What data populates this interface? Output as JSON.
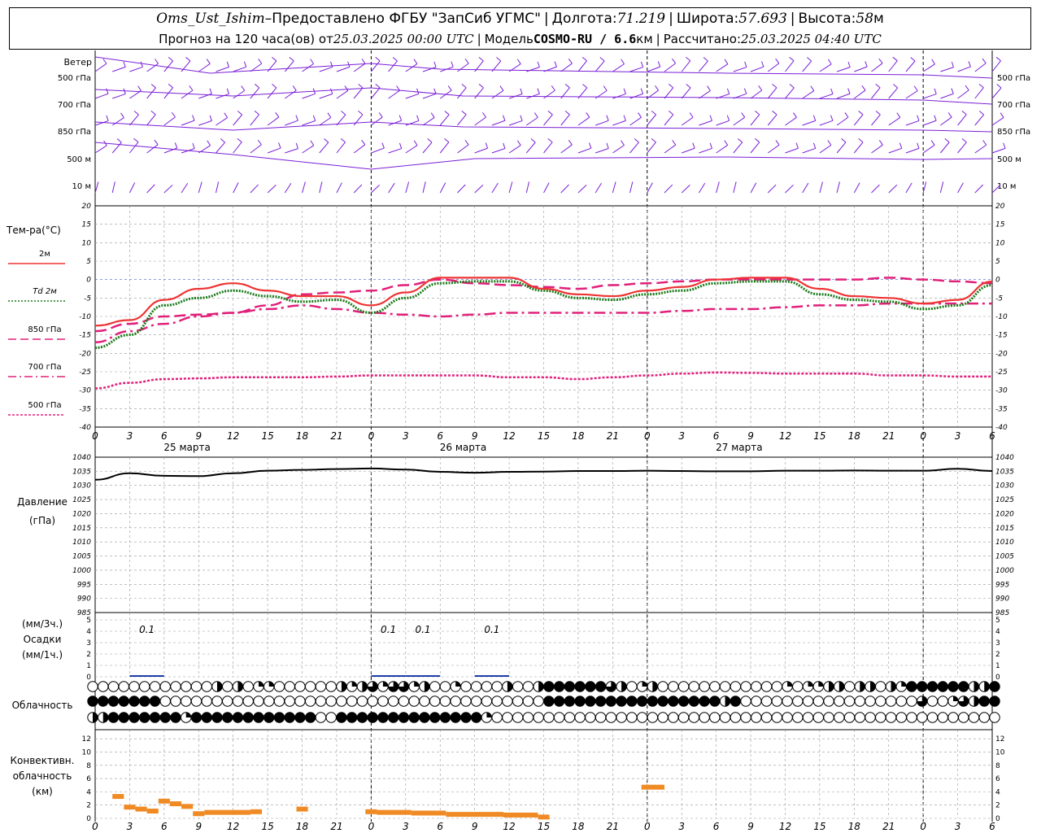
{
  "header": {
    "station": "Oms_Ust_Ishim",
    "dash": " – ",
    "provider": "Предоставлено ФГБУ \"ЗапСиб УГМС\"",
    "lon_label": "Долгота: ",
    "lon_value": "71.219",
    "lat_label": "Широта: ",
    "lat_value": "57.693",
    "alt_label": "Высота: ",
    "alt_value": "58",
    "alt_unit": "м",
    "forecast_label": "Прогноз на 120 часа(ов) от ",
    "forecast_date": "25.03.2025 00:00 UTC",
    "model_label": "Модель ",
    "model_value": "COSMO-RU / 6.6",
    "model_unit": "км",
    "calc_label": "Рассчитано: ",
    "calc_date": "25.03.2025 04:40 UTC",
    "separator": "|"
  },
  "time_axis": {
    "tick_labels": [
      "0",
      "3",
      "6",
      "9",
      "12",
      "15",
      "18",
      "21",
      "0",
      "3",
      "6",
      "9",
      "12",
      "15",
      "18",
      "21",
      "0",
      "3",
      "6",
      "9",
      "12",
      "15",
      "18",
      "21",
      "0",
      "3",
      "6"
    ],
    "days": [
      "25 марта",
      "26 марта",
      "27 марта"
    ]
  },
  "wind_panel": {
    "title": "Ветер",
    "levels": [
      "500 гПа",
      "700 гПа",
      "850 гПа",
      "500  м",
      "10  м"
    ],
    "right_levels": [
      "500 гПа",
      "700 гПа",
      "850 гПа",
      "500 м",
      "10 м"
    ],
    "color": "#7a1fd6"
  },
  "chart_data": [
    {
      "type": "line",
      "title": "Тем-ра(°С)",
      "ylim": [
        -40,
        20
      ],
      "y_ticks": [
        "20",
        "15",
        "10",
        "5",
        "0",
        "-5",
        "-10",
        "-15",
        "-20",
        "-25",
        "-30",
        "-35",
        "-40"
      ],
      "x_hours": [
        0,
        3,
        6,
        9,
        12,
        15,
        18,
        21,
        24,
        27,
        30,
        33,
        36,
        39,
        42,
        45,
        48,
        51,
        54,
        57,
        60,
        63,
        66,
        69,
        72,
        75,
        78
      ],
      "series": [
        {
          "name": "2м",
          "color": "#ee3333",
          "style": "solid",
          "values": [
            -12.5,
            -11,
            -5.5,
            -2.5,
            -1,
            -3,
            -4.5,
            -4.5,
            -7,
            -3.5,
            0.5,
            0.5,
            0.5,
            -2.5,
            -4,
            -4.5,
            -3,
            -2,
            0,
            0.5,
            0.5,
            -2.5,
            -4.5,
            -5,
            -6.5,
            -5.5,
            -0.5
          ]
        },
        {
          "name": "Td  2м",
          "color": "#1a7a1a",
          "style": "dotted",
          "values": [
            -18.5,
            -15,
            -7,
            -5,
            -3,
            -4.5,
            -6,
            -5.5,
            -9,
            -5,
            -1,
            -0.5,
            -0.5,
            -3,
            -5,
            -5.5,
            -4,
            -3,
            -1,
            -0.5,
            -0.5,
            -4,
            -5.5,
            -6,
            -8,
            -7,
            -1.5
          ]
        },
        {
          "name": "850 гПа",
          "color": "#e0207a",
          "style": "dash",
          "values": [
            -14,
            -12,
            -10,
            -9.5,
            -9,
            -7,
            -4,
            -3.5,
            -3,
            -1.5,
            0,
            -1,
            -1.5,
            -2,
            -2.5,
            -1.5,
            -1,
            -0.5,
            0,
            0,
            0,
            0,
            0,
            0.5,
            0,
            -0.5,
            -1
          ]
        },
        {
          "name": "700 гПа",
          "color": "#e0207a",
          "style": "dashdot",
          "values": [
            -17,
            -14,
            -12,
            -10,
            -9,
            -8,
            -7,
            -8,
            -9,
            -9.5,
            -10,
            -9.5,
            -9,
            -9,
            -9,
            -9,
            -9,
            -8.5,
            -8,
            -8,
            -7.5,
            -7,
            -7,
            -6.5,
            -6.5,
            -6.5,
            -6.5
          ]
        },
        {
          "name": "500 гПа",
          "color": "#e0207a",
          "style": "densedot",
          "values": [
            -29.5,
            -28,
            -27,
            -26.8,
            -26.5,
            -26.5,
            -26.5,
            -26.3,
            -26,
            -26,
            -26,
            -26,
            -26.5,
            -26.5,
            -27,
            -26.5,
            -26,
            -25.5,
            -25.2,
            -25.3,
            -25.5,
            -25.5,
            -25.5,
            -26,
            -26,
            -26.3,
            -26.3
          ]
        }
      ]
    },
    {
      "type": "line",
      "title": "Давление",
      "unit": "(гПа)",
      "ylim": [
        985,
        1040
      ],
      "y_ticks": [
        "1040",
        "1035",
        "1030",
        "1025",
        "1020",
        "1015",
        "1010",
        "1005",
        "1000",
        "995",
        "990",
        "985"
      ],
      "x_hours": [
        0,
        3,
        6,
        9,
        12,
        15,
        18,
        21,
        24,
        27,
        30,
        33,
        36,
        39,
        42,
        45,
        48,
        51,
        54,
        57,
        60,
        63,
        66,
        69,
        72,
        75,
        78
      ],
      "series": [
        {
          "name": "Давление",
          "color": "#000000",
          "values": [
            1032,
            1034.3,
            1033.4,
            1033.3,
            1034.3,
            1035.2,
            1035.5,
            1035.8,
            1036,
            1035.6,
            1034.8,
            1034.5,
            1034.8,
            1034.9,
            1035.1,
            1035.1,
            1035.2,
            1035.1,
            1035,
            1035,
            1035.2,
            1035.2,
            1035.3,
            1035.2,
            1035.2,
            1035.9,
            1035.1
          ]
        }
      ]
    },
    {
      "type": "bar",
      "title": "Осадки",
      "unit_top": "(мм/3ч.)",
      "unit_bottom": "(мм/1ч.)",
      "ylim": [
        0,
        5
      ],
      "y_ticks": [
        "5",
        "4",
        "3",
        "2",
        "1",
        "0"
      ],
      "bars": [
        {
          "x": 4.5,
          "value": 0.1
        },
        {
          "x": 25.5,
          "value": 0.05
        },
        {
          "x": 28.5,
          "value": 0.05
        },
        {
          "x": 34.5,
          "value": 0.05
        }
      ],
      "labels": [
        {
          "x": 4.5,
          "text": "0.1"
        },
        {
          "x": 25.5,
          "text": "0.1"
        },
        {
          "x": 28.5,
          "text": "0.1"
        },
        {
          "x": 34.5,
          "text": "0.1"
        }
      ],
      "color": "#1e3ea8"
    },
    {
      "type": "bar",
      "title": "Конвективн.",
      "title2": "облачность",
      "unit": "(км)",
      "ylim": [
        0,
        13
      ],
      "y_ticks": [
        "12",
        "10",
        "8",
        "6",
        "4",
        "2",
        "0"
      ],
      "color": "#f08a24",
      "segments": [
        {
          "x0": 1.5,
          "x1": 2.5,
          "value": 3.3
        },
        {
          "x0": 2.5,
          "x1": 3.5,
          "value": 1.7
        },
        {
          "x0": 3.5,
          "x1": 4.5,
          "value": 1.4
        },
        {
          "x0": 4.5,
          "x1": 5.5,
          "value": 1.1
        },
        {
          "x0": 5.5,
          "x1": 6.5,
          "value": 2.6
        },
        {
          "x0": 6.5,
          "x1": 7.5,
          "value": 2.2
        },
        {
          "x0": 7.5,
          "x1": 8.5,
          "value": 1.8
        },
        {
          "x0": 8.5,
          "x1": 9.5,
          "value": 0.7
        },
        {
          "x0": 9.5,
          "x1": 13.5,
          "value": 0.9
        },
        {
          "x0": 13.5,
          "x1": 14.5,
          "value": 1.0
        },
        {
          "x0": 17.5,
          "x1": 18.5,
          "value": 1.4
        },
        {
          "x0": 23.5,
          "x1": 24.5,
          "value": 1.0
        },
        {
          "x0": 24.5,
          "x1": 27.5,
          "value": 0.9
        },
        {
          "x0": 27.5,
          "x1": 30.5,
          "value": 0.8
        },
        {
          "x0": 30.5,
          "x1": 35.5,
          "value": 0.6
        },
        {
          "x0": 35.5,
          "x1": 38.5,
          "value": 0.5
        },
        {
          "x0": 38.5,
          "x1": 39.5,
          "value": 0.2
        },
        {
          "x0": 47.5,
          "x1": 49.5,
          "value": 4.7
        }
      ]
    }
  ],
  "cloud_panel": {
    "title": "Облачность",
    "rows": [
      [
        0,
        0,
        0,
        0,
        0,
        0,
        0,
        0,
        0,
        0,
        0,
        0,
        1,
        0,
        1,
        0,
        2,
        2,
        0,
        0,
        0,
        0,
        0,
        0,
        1,
        2,
        1,
        3,
        2,
        3,
        3,
        2,
        1,
        0,
        0,
        2,
        0,
        0,
        0,
        0,
        1,
        0,
        0,
        1,
        4,
        4,
        4,
        4,
        4,
        4,
        3,
        1,
        0,
        2,
        1,
        0,
        0,
        0,
        0,
        0,
        0,
        0,
        0,
        0,
        0,
        0,
        0,
        2,
        0,
        2,
        2,
        1,
        1,
        0,
        1,
        1,
        0,
        1,
        2,
        4,
        4,
        4,
        4,
        4,
        4,
        1,
        1,
        4
      ],
      [
        4,
        4,
        4,
        4,
        4,
        4,
        4,
        0,
        0,
        0,
        0,
        0,
        0,
        0,
        0,
        0,
        0,
        0,
        0,
        0,
        0,
        0,
        0,
        0,
        0,
        0,
        0,
        0,
        0,
        0,
        0,
        0,
        0,
        0,
        0,
        0,
        0,
        0,
        0,
        0,
        0,
        0,
        0,
        0,
        4,
        4,
        4,
        4,
        4,
        4,
        4,
        4,
        4,
        4,
        4,
        4,
        4,
        4,
        4,
        4,
        4,
        1,
        4,
        0,
        0,
        0,
        0,
        0,
        0,
        0,
        0,
        0,
        0,
        0,
        0,
        0,
        0,
        0,
        0,
        0,
        3,
        0,
        0,
        2,
        3,
        1,
        4,
        4
      ],
      [
        1,
        1,
        4,
        4,
        4,
        4,
        4,
        4,
        4,
        2,
        4,
        4,
        4,
        4,
        4,
        4,
        4,
        4,
        4,
        4,
        4,
        4,
        0,
        0,
        4,
        4,
        4,
        4,
        4,
        4,
        4,
        4,
        4,
        4,
        4,
        4,
        4,
        4,
        2,
        0,
        0,
        0,
        0,
        0,
        0,
        0,
        0,
        0,
        0,
        0,
        0,
        0,
        0,
        0,
        0,
        0,
        0,
        0,
        0,
        0,
        0,
        0,
        0,
        0,
        0,
        0,
        0,
        0,
        0,
        0,
        0,
        0,
        0,
        0,
        0,
        0,
        0,
        0,
        0,
        0,
        0,
        0,
        0,
        0,
        0,
        0,
        0,
        0
      ]
    ]
  },
  "ui": {
    "temp_legend": [
      "2м",
      "Td  2м",
      "850 гПа",
      "700 гПа",
      "500 гПа"
    ],
    "conv_ticks_right": [
      "12",
      "10",
      "8",
      "6",
      "4",
      "2",
      "0"
    ]
  }
}
